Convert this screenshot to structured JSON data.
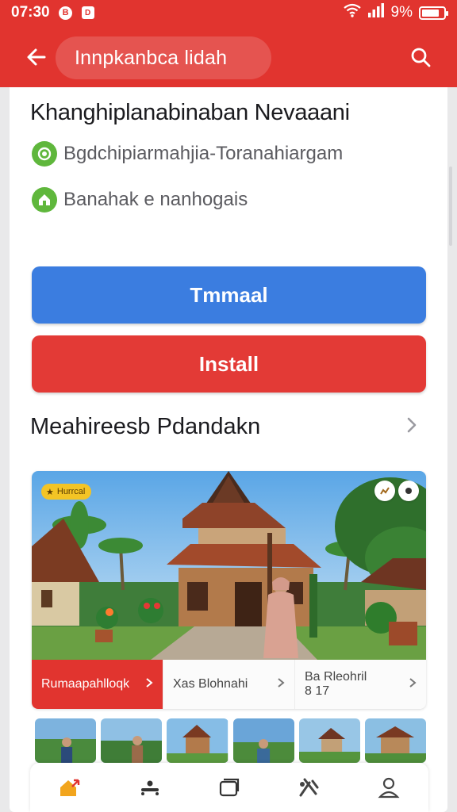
{
  "status": {
    "time": "07:30",
    "battery": "9%",
    "battery_level": 0.7,
    "notif_icons": [
      "notification-b-icon",
      "notification-d-icon"
    ]
  },
  "appbar": {
    "title": "Innpkanbca lidah",
    "back_icon": "back-arrow-icon",
    "search_icon": "search-icon"
  },
  "app": {
    "title": "Khanghiplanabinaban Nevaaani",
    "info_rows": [
      {
        "icon": "target-icon",
        "text": "Bgdchipiarmahjia-Toranahiargam"
      },
      {
        "icon": "home-badge-icon",
        "text": "Banahak e nanhogais"
      }
    ]
  },
  "buttons": {
    "primary_label": "Tmmaal",
    "install_label": "Install"
  },
  "section": {
    "title": "Meahireesb Pdandakn",
    "chevron_icon": "chevron-right-icon"
  },
  "gallery": {
    "badge": "Hurrcal",
    "tabs": [
      {
        "label": "Rumaapahlloqk",
        "active": true
      },
      {
        "label": "Xas Blohnahi",
        "active": false
      },
      {
        "label": "Ba Rleohril",
        "sub": "8 17",
        "active": false
      }
    ]
  },
  "bottom_nav": [
    {
      "icon": "home-icon"
    },
    {
      "icon": "community-icon"
    },
    {
      "icon": "tabs-icon"
    },
    {
      "icon": "tools-icon"
    },
    {
      "icon": "profile-icon"
    }
  ],
  "colors": {
    "brand_red": "#e1342f",
    "primary_blue": "#3b7de0",
    "install_red": "#e33a36",
    "accent_green": "#5fb73c"
  }
}
